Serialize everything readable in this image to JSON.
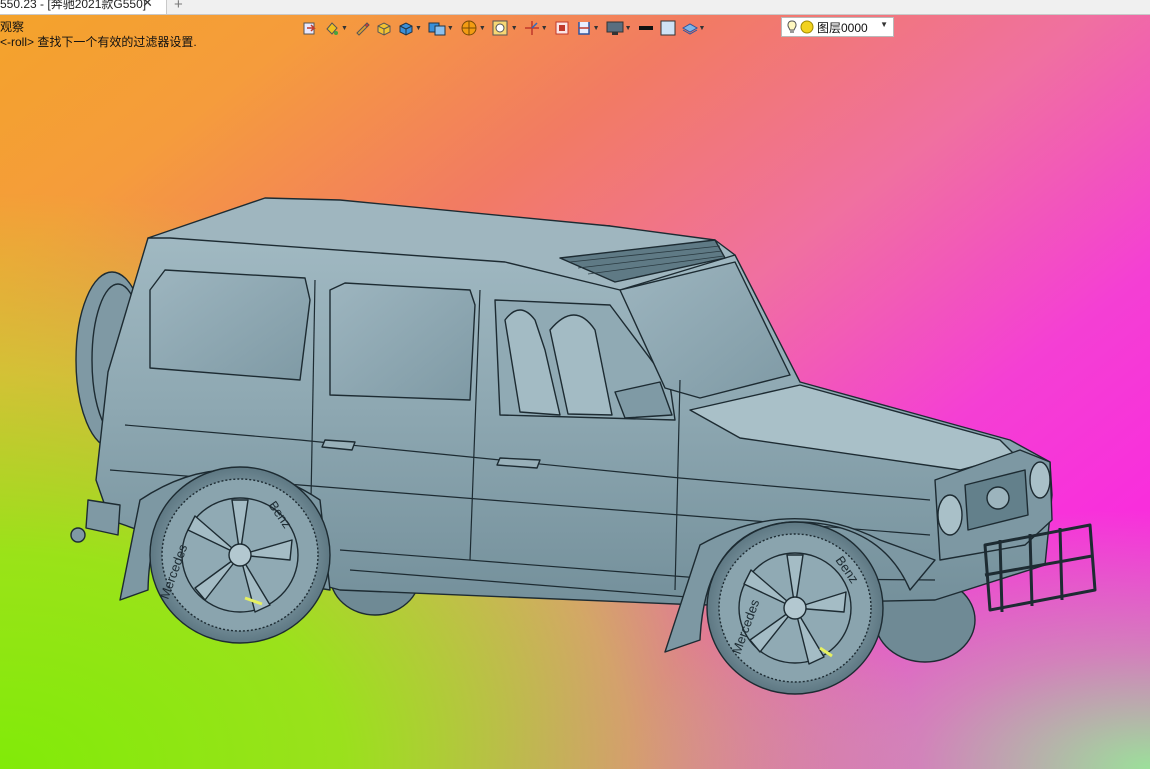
{
  "tab": {
    "title": "550.23 - [奔驰2021款G550]",
    "close_glyph": "✕",
    "new_glyph": "+"
  },
  "prompt": {
    "line1": "观察",
    "line2": "<-roll> 查找下一个有效的过滤器设置."
  },
  "toolbar": {
    "icons": [
      "snap-icon",
      "paint-bucket-icon",
      "pencil-icon",
      "box-edit-icon",
      "cube-shade-icon",
      "render-mode-icon",
      "sphere-view-icon",
      "zoom-fit-icon",
      "axis-icon",
      "frame-icon",
      "section-icon",
      "display-icon",
      "line-color-swatch",
      "fill-swatch",
      "layer-stack-icon"
    ],
    "layer": {
      "value": "图层0000",
      "icon_bulb": "lightbulb-icon",
      "icon_sun": "sun-icon"
    }
  },
  "model": {
    "wheel_text_front": "Mercedes",
    "wheel_text_back": "Benz",
    "body_color": "#8ea8b2",
    "edge_color": "#1d2b32"
  }
}
